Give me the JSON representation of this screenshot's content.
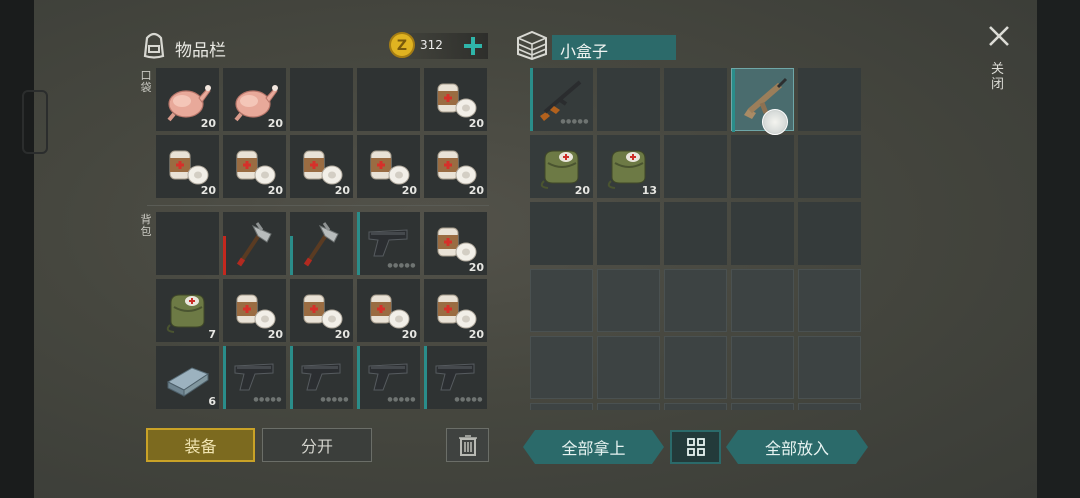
{
  "inventory": {
    "title": "物品栏",
    "coins": "312",
    "pocket_label": "口袋",
    "backpack_label": "背包",
    "pocket": [
      {
        "item": "chicken",
        "count": "20"
      },
      {
        "item": "chicken",
        "count": "20"
      },
      {
        "item": "empty",
        "count": ""
      },
      {
        "item": "empty",
        "count": ""
      },
      {
        "item": "bandage",
        "count": "20"
      },
      {
        "item": "bandage",
        "count": "20"
      },
      {
        "item": "bandage",
        "count": "20"
      },
      {
        "item": "bandage",
        "count": "20"
      },
      {
        "item": "bandage",
        "count": "20"
      },
      {
        "item": "bandage",
        "count": "20"
      }
    ],
    "backpack": [
      {
        "item": "empty",
        "count": ""
      },
      {
        "item": "hatchet",
        "count": ""
      },
      {
        "item": "hatchet",
        "count": ""
      },
      {
        "item": "pistol",
        "count": ""
      },
      {
        "item": "bandage",
        "count": "20"
      },
      {
        "item": "medkit",
        "count": "7"
      },
      {
        "item": "bandage",
        "count": "20"
      },
      {
        "item": "bandage",
        "count": "20"
      },
      {
        "item": "bandage",
        "count": "20"
      },
      {
        "item": "bandage",
        "count": "20"
      },
      {
        "item": "metal-bar",
        "count": "6"
      },
      {
        "item": "pistol",
        "count": ""
      },
      {
        "item": "pistol",
        "count": ""
      },
      {
        "item": "pistol",
        "count": ""
      },
      {
        "item": "pistol",
        "count": ""
      }
    ],
    "equip_label": "装备",
    "split_label": "分开"
  },
  "box": {
    "title": "小盒子",
    "take_all_label": "全部拿上",
    "put_all_label": "全部放入",
    "slots": [
      {
        "item": "rifle",
        "count": ""
      },
      {
        "item": "empty",
        "count": ""
      },
      {
        "item": "empty",
        "count": ""
      },
      {
        "item": "assault-rifle",
        "count": ""
      },
      {
        "item": "empty",
        "count": ""
      },
      {
        "item": "medkit",
        "count": "20"
      },
      {
        "item": "medkit",
        "count": "13"
      },
      {
        "item": "empty",
        "count": ""
      },
      {
        "item": "empty",
        "count": ""
      },
      {
        "item": "empty",
        "count": ""
      }
    ]
  },
  "close_label": "关闭",
  "colors": {
    "accent_teal": "#2b6a6a",
    "equip_gold": "#c9a227",
    "coin": "#e0b321"
  }
}
